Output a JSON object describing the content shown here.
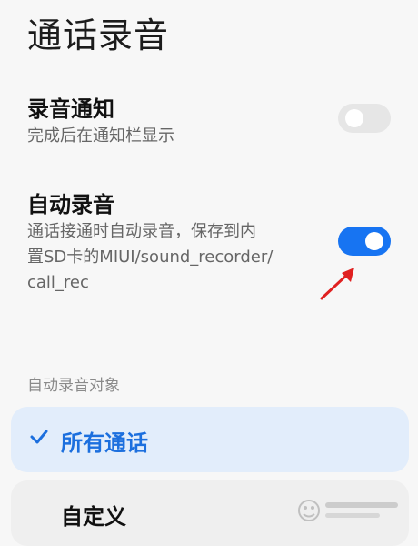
{
  "page": {
    "title": "通话录音"
  },
  "settings": [
    {
      "title": "录音通知",
      "description": "完成后在通知栏显示",
      "enabled": false
    },
    {
      "title": "自动录音",
      "description_lines": [
        "通话接通时自动录音，保存到内",
        "置SD卡的MIUI/sound_recorder/",
        "call_rec"
      ],
      "enabled": true
    }
  ],
  "section": {
    "header": "自动录音对象",
    "options": [
      {
        "label": "所有通话",
        "selected": true
      },
      {
        "label": "自定义",
        "selected": false
      }
    ]
  },
  "colors": {
    "accent": "#1774f2",
    "selected_bg": "#e2edfb",
    "annotation_arrow": "#e02020"
  },
  "annotation": {
    "icon": "red-arrow-icon"
  }
}
